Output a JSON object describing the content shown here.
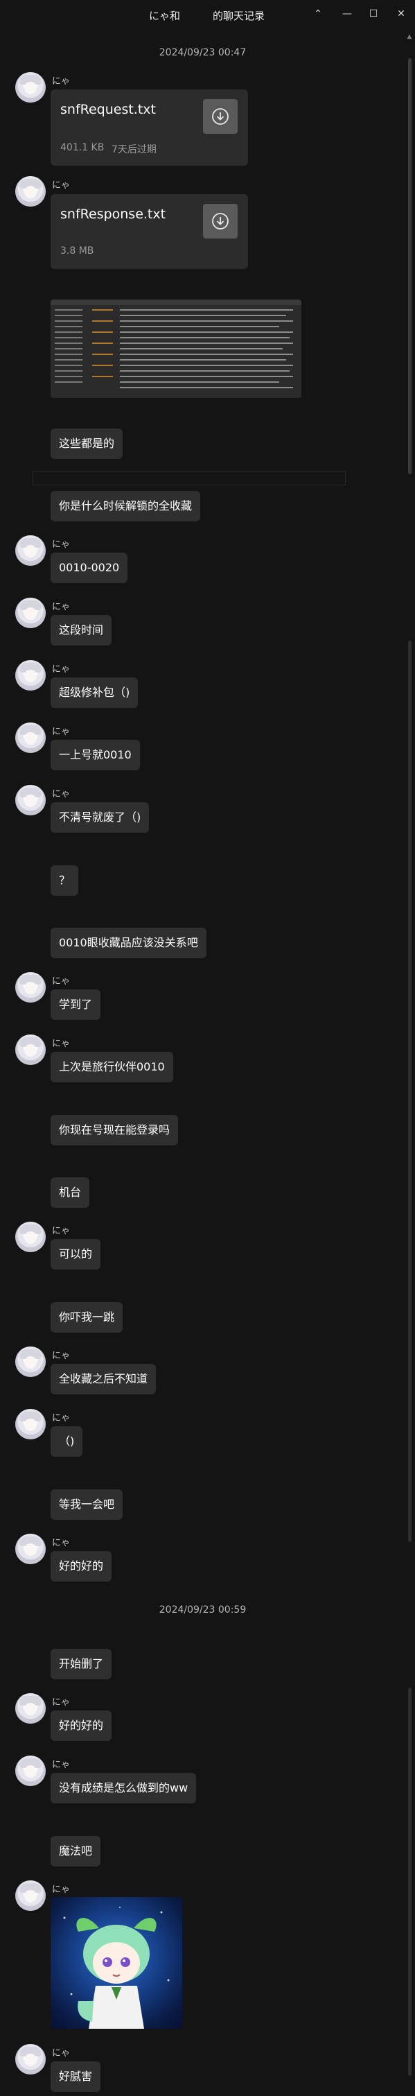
{
  "window": {
    "title_left": "にゃ和",
    "title_right": "的聊天记录",
    "minimize_glyph": "—",
    "maximize_glyph": "☐",
    "close_glyph": "✕",
    "collapse_glyph": "⌃"
  },
  "timestamps": [
    "2024/09/23 00:47",
    "2024/09/23 00:59"
  ],
  "files": [
    {
      "sender": "にゃ",
      "name": "snfRequest.txt",
      "size": "401.1 KB",
      "expiry": "7天后过期"
    },
    {
      "sender": "にゃ",
      "name": "snfResponse.txt",
      "size": "3.8 MB",
      "expiry": ""
    }
  ],
  "messages": [
    {
      "sender": "",
      "text": "这些都是的"
    },
    {
      "sender": "",
      "text": "你是什么时候解锁的全收藏"
    },
    {
      "sender": "にゃ",
      "text": "0010-0020"
    },
    {
      "sender": "にゃ",
      "text": "这段时间"
    },
    {
      "sender": "にゃ",
      "text": "超级修补包（)"
    },
    {
      "sender": "にゃ",
      "text": "一上号就0010"
    },
    {
      "sender": "にゃ",
      "text": "不清号就废了（)"
    },
    {
      "sender": "",
      "text": "？"
    },
    {
      "sender": "",
      "text": "0010眼收藏品应该没关系吧"
    },
    {
      "sender": "にゃ",
      "text": "学到了"
    },
    {
      "sender": "にゃ",
      "text": "上次是旅行伙伴0010"
    },
    {
      "sender": "",
      "text": "你现在号现在能登录吗"
    },
    {
      "sender": "",
      "text": "机台"
    },
    {
      "sender": "にゃ",
      "text": "可以的"
    },
    {
      "sender": "",
      "text": "你吓我一跳"
    },
    {
      "sender": "にゃ",
      "text": "全收藏之后不知道"
    },
    {
      "sender": "にゃ",
      "text": "（)"
    },
    {
      "sender": "",
      "text": "等我一会吧"
    },
    {
      "sender": "にゃ",
      "text": "好的好的"
    },
    {
      "sender": "",
      "text": "开始删了"
    },
    {
      "sender": "にゃ",
      "text": "好的好的"
    },
    {
      "sender": "にゃ",
      "text": "没有成绩是怎么做到的ww"
    },
    {
      "sender": "",
      "text": "魔法吧"
    },
    {
      "sender": "にゃ",
      "text": "好腻害"
    }
  ],
  "sticker_sender": "にゃ",
  "icons": {
    "download": "download-circle-icon",
    "avatar": "anime-avatar"
  },
  "colors": {
    "background": "#141414",
    "bubble": "#2f2f2f",
    "file_card": "#2c2c2c",
    "download_button": "#5a5a5a"
  }
}
